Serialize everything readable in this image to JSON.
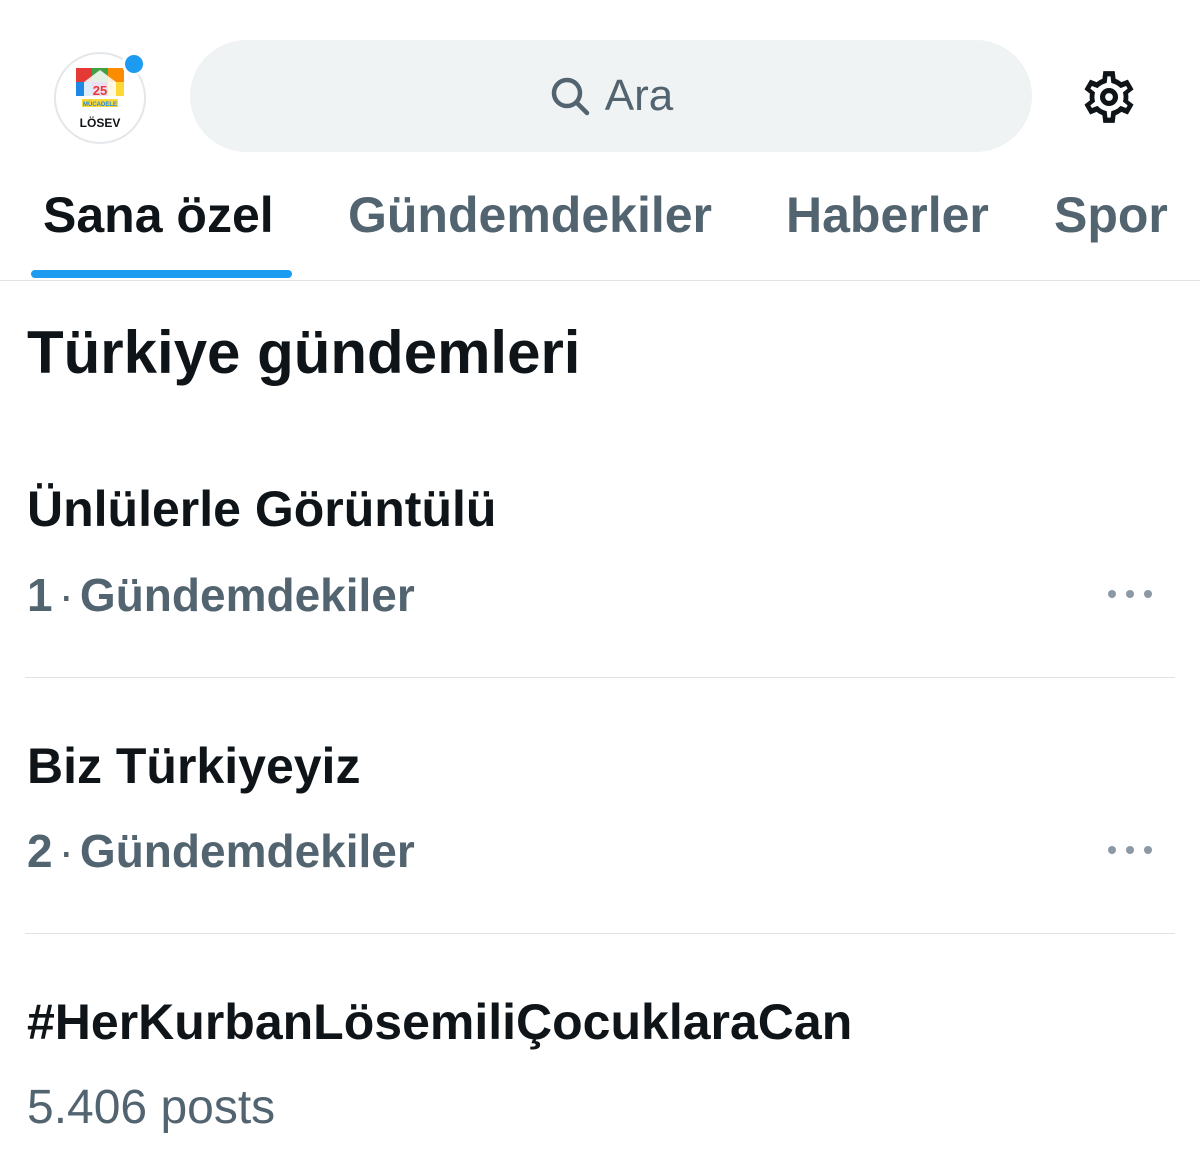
{
  "header": {
    "avatar_label": "LÖSEV",
    "search_placeholder": "Ara"
  },
  "tabs": [
    {
      "label": "Sana özel",
      "active": true
    },
    {
      "label": "Gündemdekiler",
      "active": false
    },
    {
      "label": "Haberler",
      "active": false
    },
    {
      "label": "Spor",
      "active": false
    }
  ],
  "section": {
    "title": "Türkiye gündemleri"
  },
  "trends": [
    {
      "title": "Ünlülerle Görüntülü",
      "rank": "1",
      "category": "Gündemdekiler"
    },
    {
      "title": "Biz Türkiyeyiz",
      "rank": "2",
      "category": "Gündemdekiler"
    },
    {
      "title": "#HerKurbanLösemiliÇocuklaraCan",
      "posts": "5.406 posts"
    }
  ],
  "colors": {
    "accent": "#1d9bf0",
    "text_primary": "#0f1419",
    "text_secondary": "#536471",
    "search_bg": "#eff3f4"
  },
  "icons": {
    "search": "search-icon",
    "settings": "gear-icon",
    "more": "more-horizontal-icon"
  }
}
